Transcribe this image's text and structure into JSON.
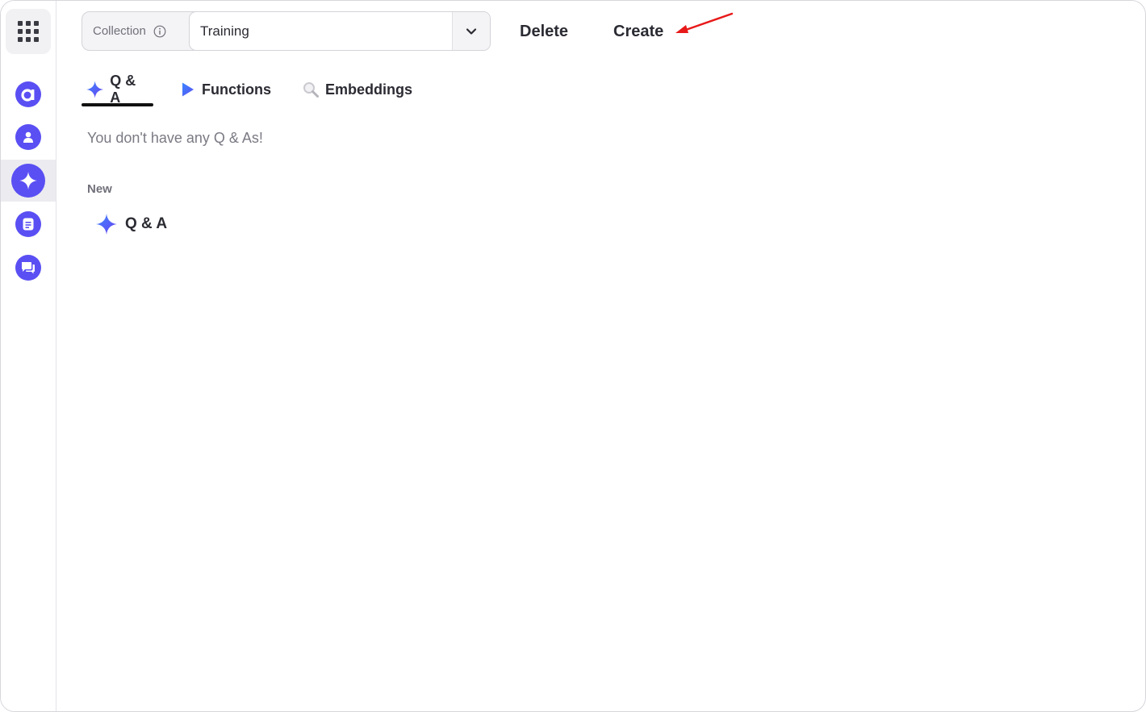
{
  "sidebar": {
    "apps_icon": "grid-icon",
    "items": [
      {
        "icon": "brand-a-icon",
        "active": false
      },
      {
        "icon": "user-icon",
        "active": false
      },
      {
        "icon": "sparkle-icon",
        "active": true
      },
      {
        "icon": "document-icon",
        "active": false
      },
      {
        "icon": "chat-icon",
        "active": false
      }
    ],
    "accent_color": "#5a4ff3"
  },
  "toolbar": {
    "collection_label": "Collection",
    "collection_value": "Training",
    "delete_label": "Delete",
    "create_label": "Create"
  },
  "tabs": [
    {
      "label": "Q & A",
      "icon": "sparkle-icon",
      "active": true
    },
    {
      "label": "Functions",
      "icon": "play-icon",
      "active": false
    },
    {
      "label": "Embeddings",
      "icon": "magnifier-icon",
      "active": false
    }
  ],
  "main": {
    "empty_message": "You don't have any Q & As!",
    "new_section_label": "New",
    "new_items": [
      {
        "label": "Q & A",
        "icon": "sparkle-icon"
      }
    ]
  },
  "annotation": {
    "arrow_color": "#e81919"
  }
}
